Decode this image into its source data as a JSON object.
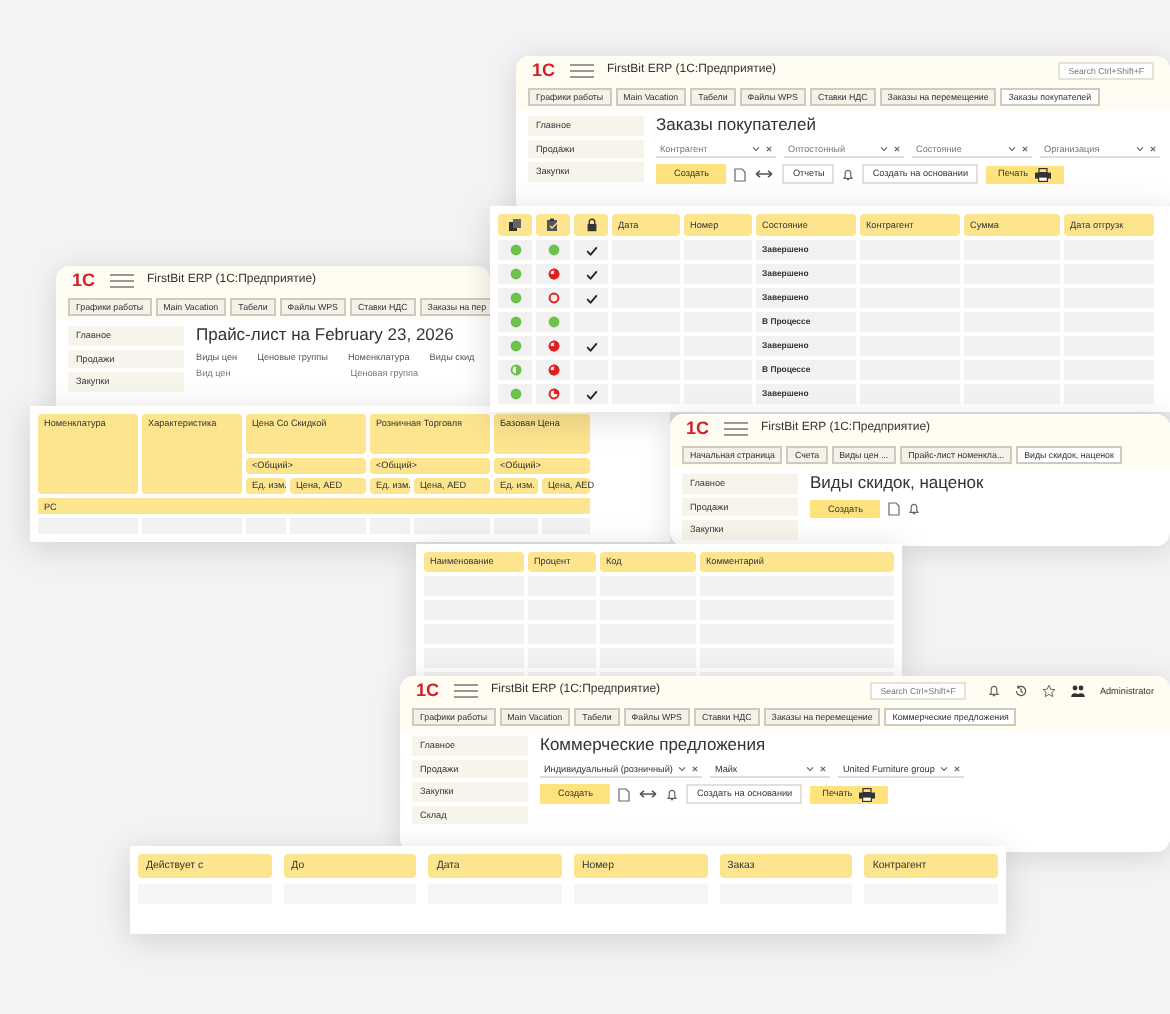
{
  "windows": [
    {
      "logo": "1С",
      "app_title": "FirstBit ERP (1С:Предприятие)",
      "search": {
        "placeholder": "Search Ctrl+Shift+F"
      },
      "tabs": [
        {
          "label": "Графики работы",
          "selected": false
        },
        {
          "label": "Main Vacation",
          "selected": false
        },
        {
          "label": "Табели",
          "selected": false
        },
        {
          "label": "Файлы WPS",
          "selected": false
        },
        {
          "label": "Ставки НДС",
          "selected": false
        },
        {
          "label": "Заказы на перемещение",
          "selected": false
        },
        {
          "label": "Заказы покупателей",
          "selected": true
        }
      ],
      "sidebar": [
        "Главное",
        "Продажи",
        "Закупки"
      ],
      "page_title": "Заказы покупателей",
      "filters": [
        {
          "placeholder": "Контрагент"
        },
        {
          "placeholder": "Оптостонный"
        },
        {
          "placeholder": "Состояние"
        },
        {
          "placeholder": "Организация"
        }
      ],
      "toolbar": [
        {
          "kind": "primary",
          "label": "Создать"
        },
        {
          "kind": "document"
        },
        {
          "kind": "arrows"
        },
        {
          "kind": "button",
          "label": "Отчеты"
        },
        {
          "kind": "bell"
        },
        {
          "kind": "button",
          "label": "Создать на основании"
        },
        {
          "kind": "print",
          "label": "Печать"
        }
      ]
    },
    {
      "logo": "1С",
      "app_title": "FirstBit ERP (1С:Предприятие)",
      "tabs": [
        {
          "label": "Графики работы",
          "selected": false
        },
        {
          "label": "Main Vacation",
          "selected": false
        },
        {
          "label": "Табели",
          "selected": false
        },
        {
          "label": "Файлы WPS",
          "selected": false
        },
        {
          "label": "Ставки НДС",
          "selected": false
        },
        {
          "label": "Заказы на пер",
          "selected": false
        }
      ],
      "sidebar": [
        "Главное",
        "Продажи",
        "Закупки"
      ],
      "page_title": "Прайс-лист на February 23, 2026",
      "links": [
        "Виды цен",
        "Ценовые группы",
        "Номенклатура",
        "Виды скид"
      ],
      "field_labels": [
        "Вид цен",
        "Ценовая группа"
      ]
    },
    {
      "logo": "1С",
      "app_title": "FirstBit ERP (1С:Предприятие)",
      "tabs": [
        {
          "label": "Начальная страница",
          "selected": false
        },
        {
          "label": "Счета",
          "selected": false
        },
        {
          "label": "Виды цен ...",
          "selected": false
        },
        {
          "label": "Прайс-лист номенкла...",
          "selected": false
        },
        {
          "label": "Виды скидок, наценок",
          "selected": true
        }
      ],
      "sidebar": [
        "Главное",
        "Продажи",
        "Закупки"
      ],
      "page_title": "Виды скидок, наценок",
      "toolbar": [
        {
          "kind": "primary",
          "label": "Создать"
        },
        {
          "kind": "document"
        },
        {
          "kind": "bell"
        }
      ]
    },
    {
      "logo": "1С",
      "app_title": "FirstBit ERP (1С:Предприятие)",
      "search": {
        "placeholder": "Search Ctrl+Shift+F"
      },
      "header_icons": [
        {
          "kind": "bell"
        },
        {
          "kind": "history"
        },
        {
          "kind": "star"
        },
        {
          "kind": "users"
        }
      ],
      "user": "Administrator",
      "tabs": [
        {
          "label": "Графики работы",
          "selected": false
        },
        {
          "label": "Main Vacation",
          "selected": false
        },
        {
          "label": "Табели",
          "selected": false
        },
        {
          "label": "Файлы WPS",
          "selected": false
        },
        {
          "label": "Ставки НДС",
          "selected": false
        },
        {
          "label": "Заказы на перемещение",
          "selected": false
        },
        {
          "label": "Коммерческие предложения",
          "selected": true
        }
      ],
      "sidebar": [
        "Главное",
        "Продажи",
        "Закупки",
        "Склад"
      ],
      "page_title": "Коммерческие предложения",
      "filters": [
        {
          "value": "Индивидуальный (розничный)"
        },
        {
          "value": "Майк"
        },
        {
          "value": "United Furniture group"
        }
      ],
      "toolbar": [
        {
          "kind": "primary",
          "label": "Создать"
        },
        {
          "kind": "document"
        },
        {
          "kind": "arrows"
        },
        {
          "kind": "bell"
        },
        {
          "kind": "button",
          "label": "Создать на основании"
        },
        {
          "kind": "print",
          "label": "Печать"
        }
      ]
    }
  ],
  "tables": [
    {
      "kind": "orders",
      "columns": [
        {
          "kind": "documents"
        },
        {
          "kind": "clipboard"
        },
        {
          "kind": "lock"
        },
        {
          "kind": "text",
          "label": "Дата"
        },
        {
          "kind": "text",
          "label": "Номер"
        },
        {
          "kind": "text",
          "label": "Состояние"
        },
        {
          "kind": "text",
          "label": "Контрагент"
        },
        {
          "kind": "text",
          "label": "Сумма"
        },
        {
          "kind": "text",
          "label": "Дата отгрузк"
        }
      ],
      "rows": [
        {
          "posted": {
            "kind": "full",
            "color": "#6cc24a"
          },
          "payment": {
            "kind": "full",
            "color": "#6cc24a"
          },
          "checked": true,
          "state": "Завершено"
        },
        {
          "posted": {
            "kind": "full",
            "color": "#6cc24a"
          },
          "payment": {
            "kind": "mostly",
            "color": "#e02020"
          },
          "checked": true,
          "state": "Завершено"
        },
        {
          "posted": {
            "kind": "full",
            "color": "#6cc24a"
          },
          "payment": {
            "kind": "ring",
            "color": "#e02020"
          },
          "checked": true,
          "state": "Завершено"
        },
        {
          "posted": {
            "kind": "full",
            "color": "#6cc24a"
          },
          "payment": {
            "kind": "full",
            "color": "#6cc24a"
          },
          "checked": false,
          "state": "В Процессе"
        },
        {
          "posted": {
            "kind": "full",
            "color": "#6cc24a"
          },
          "payment": {
            "kind": "mostly",
            "color": "#e02020"
          },
          "checked": true,
          "state": "Завершено"
        },
        {
          "posted": {
            "kind": "half",
            "color": "#6cc24a"
          },
          "payment": {
            "kind": "mostly",
            "color": "#e02020"
          },
          "checked": false,
          "state": "В Процессе"
        },
        {
          "posted": {
            "kind": "full",
            "color": "#6cc24a"
          },
          "payment": {
            "kind": "quarter",
            "color": "#e02020"
          },
          "checked": true,
          "state": "Завершено"
        }
      ]
    },
    {
      "kind": "price",
      "columns": [
        "Номенклатура",
        "Характеристика"
      ],
      "groups": [
        {
          "label": "Цена Со Скидкой",
          "subgroup": "<Общий>",
          "subcolumns": [
            "Ед. изм.",
            "Цена, AED"
          ]
        },
        {
          "label": "Розничная Торговля",
          "subgroup": "<Общий>",
          "subcolumns": [
            "Ед. изм.",
            "Цена, AED"
          ]
        },
        {
          "label": "Базовая Цена",
          "subgroup": "<Общий>",
          "subcolumns": [
            "Ед. изм.",
            "Цена, AED"
          ]
        }
      ],
      "group_row": "РС"
    },
    {
      "kind": "plain",
      "columns": [
        "Наименование",
        "Процент",
        "Код",
        "Комментарий"
      ]
    },
    {
      "kind": "plain",
      "columns": [
        "Действует с",
        "До",
        "Дата",
        "Номер",
        "Заказ",
        "Контрагент"
      ]
    }
  ]
}
